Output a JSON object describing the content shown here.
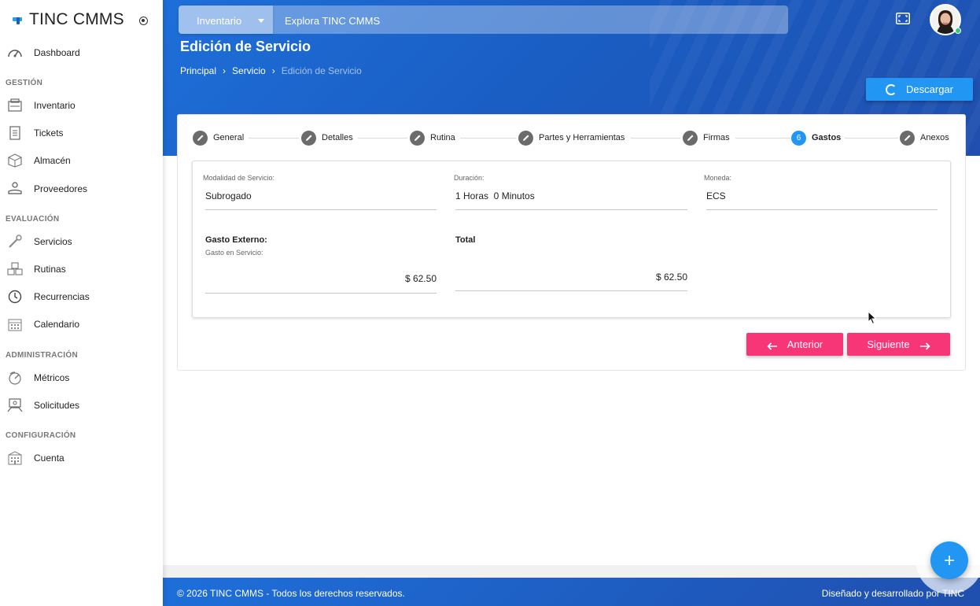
{
  "app": {
    "brand": "TINC CMMS"
  },
  "sidebar": {
    "sections": [
      {
        "title": ""
      },
      {
        "title": "GESTIÓN"
      },
      {
        "title": "EVALUACIÓN"
      },
      {
        "title": "ADMINISTRACIÓN"
      },
      {
        "title": "CONFIGURACIÓN"
      }
    ],
    "items": [
      {
        "label": "Dashboard",
        "icon": "speedometer-icon"
      },
      {
        "label": "Inventario",
        "icon": "inventory-icon"
      },
      {
        "label": "Tickets",
        "icon": "ticket-icon"
      },
      {
        "label": "Almacén",
        "icon": "box-icon"
      },
      {
        "label": "Proveedores",
        "icon": "supplier-icon"
      },
      {
        "label": "Servicios",
        "icon": "wrench-icon"
      },
      {
        "label": "Rutinas",
        "icon": "cubes-icon"
      },
      {
        "label": "Recurrencias",
        "icon": "clock-icon"
      },
      {
        "label": "Calendario",
        "icon": "calendar-icon"
      },
      {
        "label": "Métricos",
        "icon": "gauge-icon"
      },
      {
        "label": "Solicitudes",
        "icon": "request-icon"
      },
      {
        "label": "Cuenta",
        "icon": "building-icon"
      }
    ]
  },
  "header": {
    "search_category": "Inventario",
    "search_placeholder": "Explora TINC CMMS",
    "page_title": "Edición de Servicio",
    "breadcrumb": [
      "Principal",
      "Servicio",
      "Edición de Servicio"
    ],
    "download_label": "Descargar"
  },
  "stepper": {
    "steps": [
      {
        "label": "General",
        "state": "done"
      },
      {
        "label": "Detalles",
        "state": "done"
      },
      {
        "label": "Rutina",
        "state": "done"
      },
      {
        "label": "Partes y Herramientas",
        "state": "done"
      },
      {
        "label": "Firmas",
        "state": "done"
      },
      {
        "label": "Gastos",
        "state": "active",
        "number": "6"
      },
      {
        "label": "Anexos",
        "state": "done"
      }
    ]
  },
  "form": {
    "modalidad": {
      "label": "Modalidad de Servicio:",
      "value": "Subrogado"
    },
    "duracion": {
      "label": "Duración:",
      "value": "1 Horas  0 Minutos"
    },
    "moneda": {
      "label": "Moneda:",
      "value": "ECS"
    },
    "gasto_externo": {
      "title": "Gasto Externo:",
      "label": "Gasto en Servicio:",
      "value": "$ 62.50"
    },
    "total": {
      "title": "Total",
      "value": "$ 62.50"
    }
  },
  "actions": {
    "prev_label": "Anterior",
    "next_label": "Siguiente"
  },
  "footer": {
    "left": "© 2026 TINC CMMS - Todos los derechos reservados.",
    "right": "Diseñado y desarrollado por TINC"
  },
  "colors": {
    "header_blue": "#1e6fd9",
    "accent_blue": "#2196f3",
    "pink": "#f73677",
    "step_gray": "#6b6b6b"
  }
}
